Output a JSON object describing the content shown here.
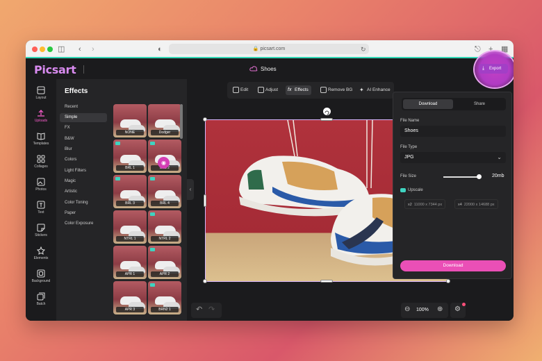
{
  "browser": {
    "url": "picsart.com"
  },
  "app": {
    "logo": "Picsart",
    "doc_title": "Shoes",
    "export_label": "Export"
  },
  "leftnav": {
    "items": [
      {
        "label": "Layout",
        "icon": "layout-icon"
      },
      {
        "label": "Uploads",
        "icon": "upload-icon",
        "active": true
      },
      {
        "label": "Templates",
        "icon": "templates-icon"
      },
      {
        "label": "Collages",
        "icon": "collages-icon"
      },
      {
        "label": "Photos",
        "icon": "photos-icon"
      },
      {
        "label": "Text",
        "icon": "text-icon"
      },
      {
        "label": "Stickers",
        "icon": "stickers-icon"
      },
      {
        "label": "Elements",
        "icon": "elements-icon"
      },
      {
        "label": "Background",
        "icon": "background-icon"
      },
      {
        "label": "Batch",
        "icon": "batch-icon"
      }
    ]
  },
  "effects": {
    "title": "Effects",
    "categories": [
      "Recent",
      "Simple",
      "FX",
      "B&W",
      "Blur",
      "Colors",
      "Light Filters",
      "Magic",
      "Artistic",
      "Color Toning",
      "Paper",
      "Color Exposure"
    ],
    "active_category": "Simple",
    "thumbs": [
      {
        "label": "NONE",
        "badge": false
      },
      {
        "label": "Dodger",
        "badge": false
      },
      {
        "label": "BRL 1",
        "badge": true
      },
      {
        "label": "BRL 2",
        "badge": true
      },
      {
        "label": "BRL 3",
        "badge": true
      },
      {
        "label": "BRL 4",
        "badge": true
      },
      {
        "label": "NTRL 1",
        "badge": false
      },
      {
        "label": "NTRL 2",
        "badge": true
      },
      {
        "label": "APR 1",
        "badge": false
      },
      {
        "label": "APR 2",
        "badge": true
      },
      {
        "label": "APR 3",
        "badge": false
      },
      {
        "label": "BRN2 1",
        "badge": true
      }
    ]
  },
  "toolbar": {
    "items": [
      "Edit",
      "Adjust",
      "Effects",
      "Remove BG",
      "AI Enhance"
    ],
    "active": "Effects"
  },
  "zoom": {
    "value": "100%"
  },
  "export_panel": {
    "tabs": [
      "Download",
      "Share"
    ],
    "active_tab": "Download",
    "file_name_label": "File Name",
    "file_name": "Shoes",
    "file_type_label": "File Type",
    "file_type": "JPG",
    "file_size_label": "File Size",
    "file_size": "20mb",
    "file_size_fraction": 0.95,
    "upscale_label": "Upscale",
    "upscale_options": [
      {
        "factor": "x2",
        "dims": "11000 x 7344 px"
      },
      {
        "factor": "x4",
        "dims": "22000 x 14688 px"
      }
    ],
    "download_label": "Download"
  },
  "colors": {
    "accent_pink": "#ea4fb6",
    "accent_teal": "#2fd5b4",
    "export_purple": "#a23fc6"
  }
}
